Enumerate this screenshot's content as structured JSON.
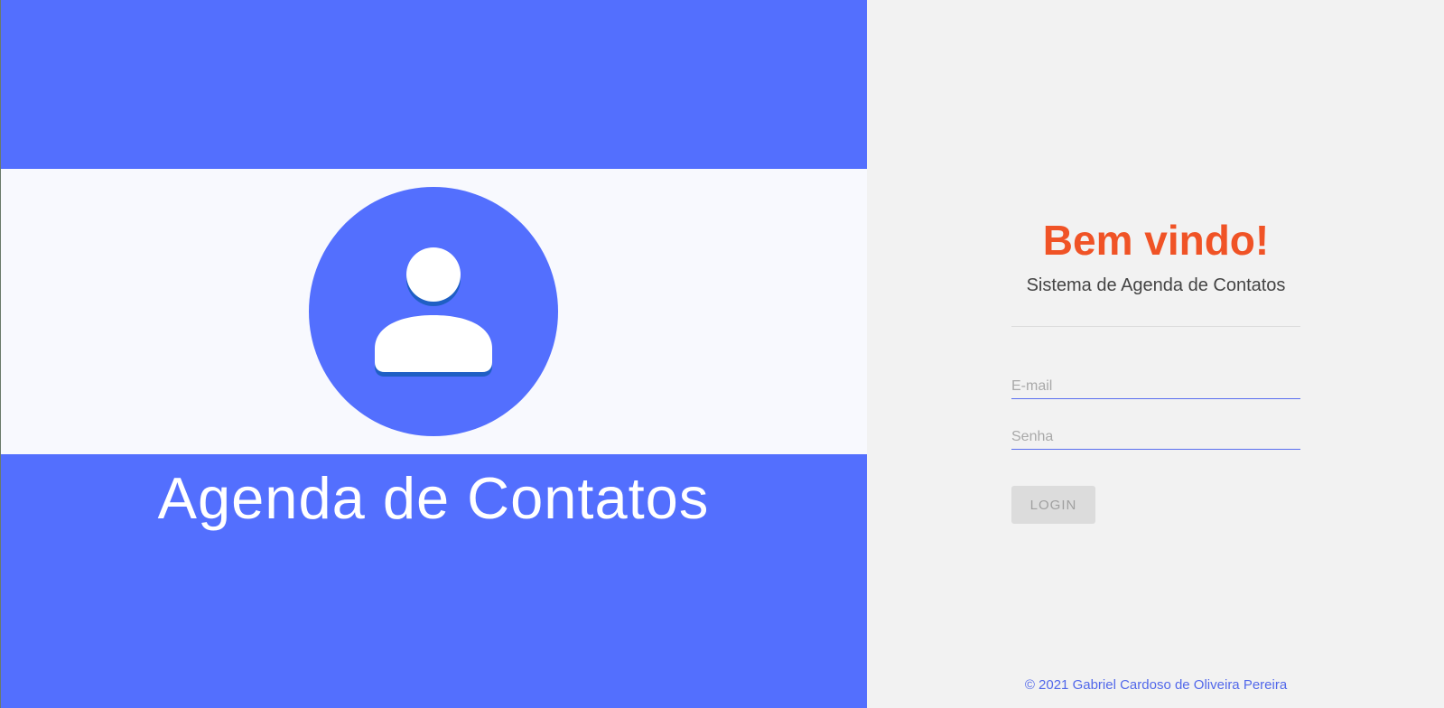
{
  "left": {
    "app_title": "Agenda de Contatos",
    "logo_icon": "contacts-person-icon"
  },
  "right": {
    "welcome": "Bem vindo!",
    "subtitle": "Sistema de Agenda de Contatos",
    "email_placeholder": "E-mail",
    "email_value": "",
    "password_placeholder": "Senha",
    "password_value": "",
    "login_label": "LOGIN",
    "footer": "© 2021 Gabriel Cardoso de Oliveira Pereira"
  },
  "colors": {
    "brand_blue": "#536ffe",
    "accent_orange": "#f05326",
    "band_light": "#f8f9fe",
    "panel_gray": "#f2f2f2"
  }
}
